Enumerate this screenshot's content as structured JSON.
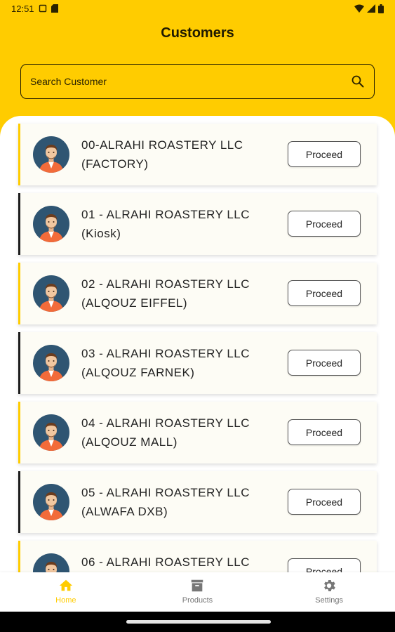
{
  "status_bar": {
    "time": "12:51"
  },
  "header": {
    "title": "Customers"
  },
  "search": {
    "placeholder": "Search Customer",
    "value": ""
  },
  "customers": [
    {
      "name": "00-ALRAHI ROASTERY LLC (FACTORY)",
      "action": "Proceed",
      "accent": "#ffcc00"
    },
    {
      "name": "01 - ALRAHI ROASTERY LLC (Kiosk)",
      "action": "Proceed",
      "accent": "#1c1c1c"
    },
    {
      "name": "02 - ALRAHI ROASTERY LLC (ALQOUZ EIFFEL)",
      "action": "Proceed",
      "accent": "#ffcc00"
    },
    {
      "name": "03 - ALRAHI ROASTERY LLC (ALQOUZ FARNEK)",
      "action": "Proceed",
      "accent": "#1c1c1c"
    },
    {
      "name": "04 - ALRAHI ROASTERY LLC (ALQOUZ MALL)",
      "action": "Proceed",
      "accent": "#ffcc00"
    },
    {
      "name": "05 - ALRAHI ROASTERY LLC (ALWAFA DXB)",
      "action": "Proceed",
      "accent": "#1c1c1c"
    },
    {
      "name": "06 - ALRAHI ROASTERY LLC",
      "action": "Proceed",
      "accent": "#ffcc00"
    }
  ],
  "bottom_nav": [
    {
      "label": "Home",
      "icon": "home-icon",
      "active": true
    },
    {
      "label": "Products",
      "icon": "archive-box-icon",
      "active": false
    },
    {
      "label": "Settings",
      "icon": "gear-icon",
      "active": false
    }
  ],
  "colors": {
    "primary": "#ffcc00",
    "text": "#222222",
    "card_bg": "#fdfcf5",
    "inactive_nav": "#777777"
  }
}
